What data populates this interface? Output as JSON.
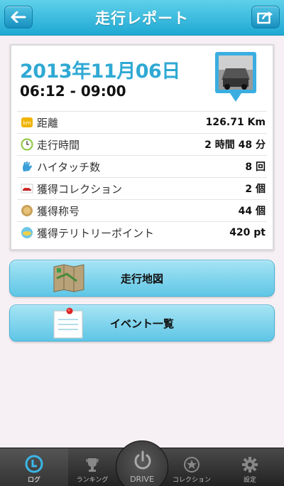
{
  "header": {
    "title": "走行レポート"
  },
  "report": {
    "date": "2013年11月06日",
    "time_range": "06:12 - 09:00",
    "stats": [
      {
        "icon": "km-icon",
        "label": "距離",
        "value": "126.71 Km"
      },
      {
        "icon": "clock-icon",
        "label": "走行時間",
        "value": "2 時間 48 分"
      },
      {
        "icon": "high-five-hand-icon",
        "label": "ハイタッチ数",
        "value": "8 回"
      },
      {
        "icon": "car-icon",
        "label": "獲得コレクション",
        "value": "2 個"
      },
      {
        "icon": "medal-icon",
        "label": "獲得称号",
        "value": "44 個"
      },
      {
        "icon": "spot-icon",
        "label": "獲得テリトリーポイント",
        "value": "420 pt"
      }
    ]
  },
  "actions": {
    "map_label": "走行地図",
    "events_label": "イベント一覧"
  },
  "tabbar": {
    "log": "ログ",
    "ranking": "ランキング",
    "drive": "DRIVE",
    "collection": "コレクション",
    "settings": "設定"
  },
  "colors": {
    "accent": "#2fa9d4",
    "header": "#1fa9d3",
    "button": "#7dd3ee"
  }
}
